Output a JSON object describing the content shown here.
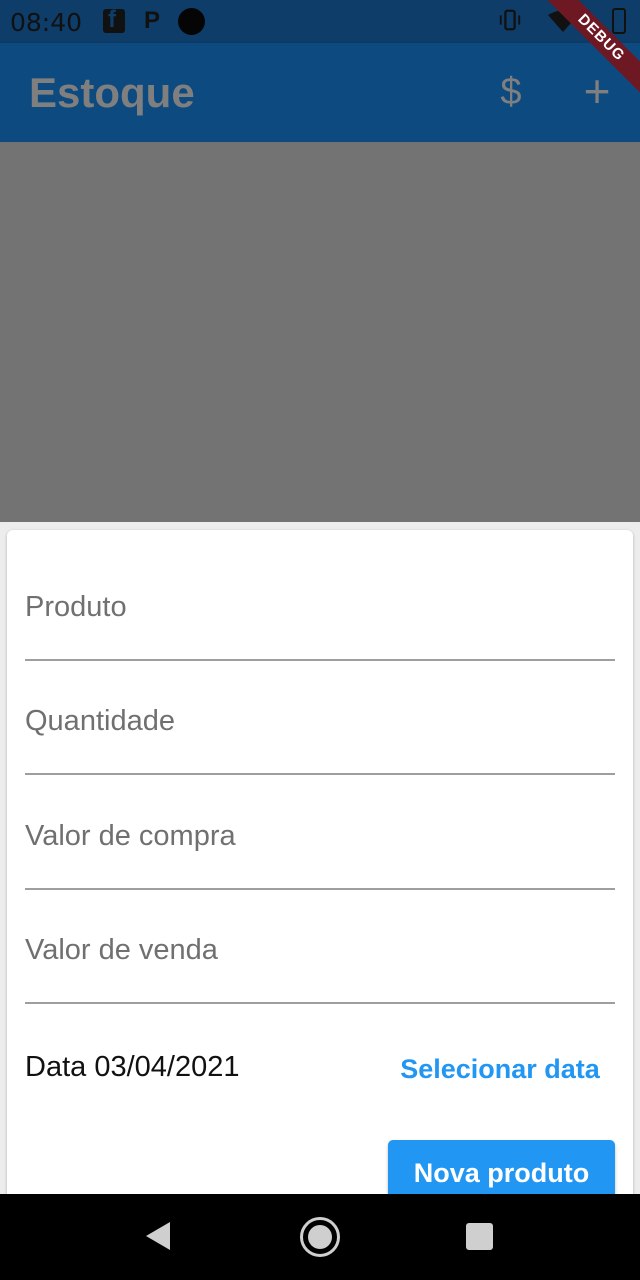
{
  "status_bar": {
    "time": "08:40",
    "icons": [
      "facebook-icon",
      "p-icon",
      "dot-icon",
      "vibrate-icon",
      "wifi-icon",
      "battery-icon"
    ]
  },
  "app_bar": {
    "title": "Estoque",
    "actions": [
      {
        "name": "dollar",
        "glyph": "$"
      },
      {
        "name": "add",
        "glyph": "+"
      }
    ],
    "debug_label": "DEBUG",
    "color": "#0d4a80"
  },
  "form": {
    "fields": [
      {
        "label": "Produto",
        "value": ""
      },
      {
        "label": "Quantidade",
        "value": ""
      },
      {
        "label": "Valor de compra",
        "value": ""
      },
      {
        "label": "Valor de venda",
        "value": ""
      }
    ],
    "date_label": "Data 03/04/2021",
    "select_date_label": "Selecionar data",
    "submit_label": "Nova produto",
    "accent_color": "#2196f3"
  },
  "nav_bar": {
    "buttons": [
      "back",
      "home",
      "recents"
    ]
  }
}
